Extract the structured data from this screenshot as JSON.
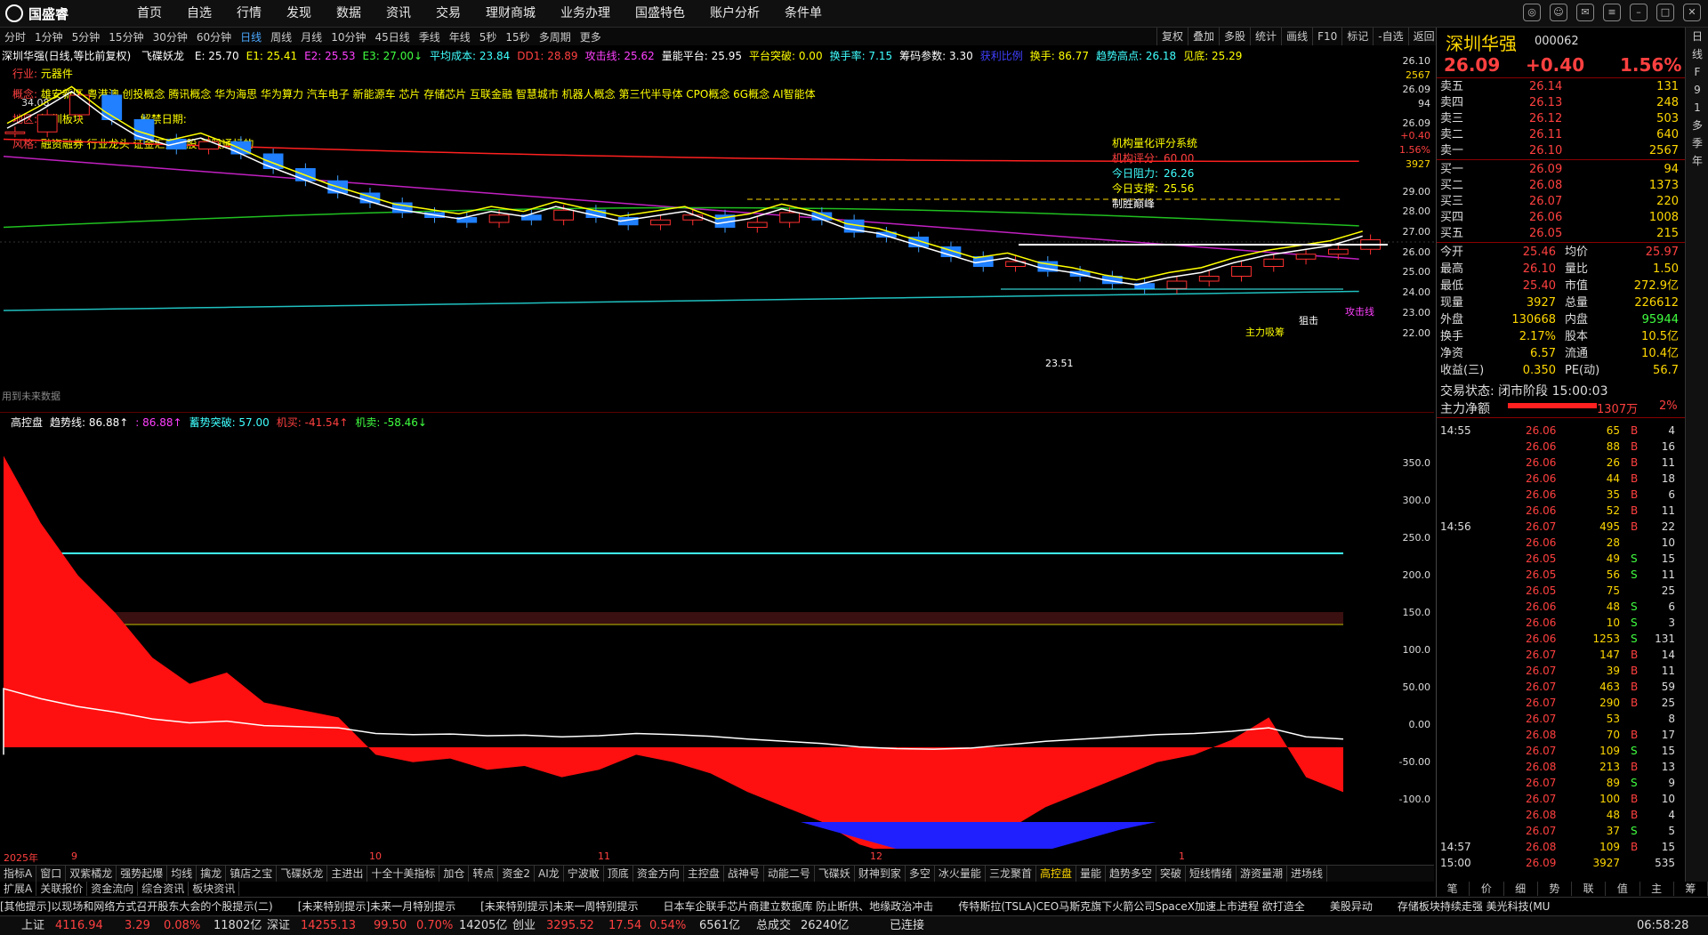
{
  "app": {
    "logo": "国盛睿"
  },
  "nav": [
    "首页",
    "自选",
    "行情",
    "发现",
    "数据",
    "资讯",
    "交易",
    "理财商城",
    "业务办理",
    "国盛特色",
    "账户分析",
    "条件单"
  ],
  "periods": [
    "分时",
    "1分钟",
    "5分钟",
    "15分钟",
    "30分钟",
    "60分钟",
    "日线",
    "周线",
    "月线",
    "10分钟",
    "45日线",
    "季线",
    "年线",
    "5秒",
    "15秒",
    "多周期",
    "更多"
  ],
  "active_period": "日线",
  "toolbar": [
    "复权",
    "叠加",
    "多股",
    "统计",
    "画线",
    "F10",
    "标记",
    "-自选",
    "返回"
  ],
  "header_line": {
    "stock": "深圳华强(日线,等比前复权)",
    "indicator": "飞碟妖龙",
    "items": [
      {
        "t": "E: 25.70",
        "c": "#ffffff"
      },
      {
        "t": "E1: 25.41",
        "c": "#ffff00"
      },
      {
        "t": "E2: 25.53",
        "c": "#ff40ff"
      },
      {
        "t": "E3: 27.00↓",
        "c": "#40ff40"
      },
      {
        "t": "平均成本: 23.84",
        "c": "#40ffff"
      },
      {
        "t": "DD1: 28.89",
        "c": "#ff4040"
      },
      {
        "t": "攻击线: 25.62",
        "c": "#ff40ff"
      },
      {
        "t": "量能平台: 25.95",
        "c": "#ffffff"
      },
      {
        "t": "平台突破: 0.00",
        "c": "#ffff00"
      },
      {
        "t": "换手率: 7.15",
        "c": "#40ffff"
      },
      {
        "t": "筹码参数: 3.30",
        "c": "#ffffff"
      },
      {
        "t": "获利比例",
        "c": "#4040ff"
      },
      {
        "t": "换手: 86.77",
        "c": "#ffff00"
      },
      {
        "t": "趋势高点: 26.18",
        "c": "#40ffff"
      },
      {
        "t": "见底: 25.29",
        "c": "#ffff00"
      }
    ]
  },
  "info": {
    "industry_label": "行业:",
    "industry": "元器件",
    "concept_label": "概念:",
    "concepts": "雄安新区 粤港澳 创投概念 腾讯概念 华为海思 华为算力 汽车电子 新能源车 芯片 存储芯片 互联金融 智慧城市 机器人概念 第三代半导体 CPO概念 6G概念 AI智能体",
    "region_label": "地区:",
    "region": "深圳板块",
    "unlock_label": "解禁日期:",
    "style_label": "风格:",
    "style": "融资融券 行业龙头 证金汇金持股 深股通标的",
    "price_mark": "34.08"
  },
  "score_box": {
    "title": "机构量化评分系统",
    "rows": [
      {
        "k": "机构评分:",
        "v": "60.00",
        "c": "#ff4040"
      },
      {
        "k": "今日阻力:",
        "v": "26.26",
        "c": "#40ffff"
      },
      {
        "k": "今日支撑:",
        "v": "25.56",
        "c": "#ffff00"
      },
      {
        "k": "制胜巅峰",
        "v": "",
        "c": "#ffffff"
      }
    ]
  },
  "chart_labels": {
    "future": "用到未来数据",
    "low_mark": "23.51",
    "main_buy": "主力吸筹",
    "attack": "攻击线",
    "fight": "狙击"
  },
  "yaxis_top": [
    "26.10",
    "2567",
    "26.09",
    "94",
    "26.09",
    "+0.40",
    "1.56%",
    "3927",
    "29.00",
    "28.00",
    "27.00",
    "26.00",
    "25.00",
    "24.00",
    "23.00",
    "22.00"
  ],
  "yaxis_bot": [
    "350.0",
    "300.0",
    "250.0",
    "200.0",
    "150.0",
    "100.0",
    "50.00",
    "0.00",
    "-50.00",
    "-100.0"
  ],
  "xaxis": [
    "2025年",
    "9",
    "10",
    "11",
    "12",
    "1"
  ],
  "sub_header": {
    "items": [
      {
        "t": "高控盘",
        "c": "#ffffff"
      },
      {
        "t": "趋势线: 86.88↑",
        "c": "#ffffff"
      },
      {
        "t": ": 86.88↑",
        "c": "#ff40ff"
      },
      {
        "t": "蓄势突破: 57.00",
        "c": "#40ffff"
      },
      {
        "t": "机买: -41.54↑",
        "c": "#ff4040"
      },
      {
        "t": "机卖: -58.46↓",
        "c": "#40ff40"
      }
    ]
  },
  "quote": {
    "name": "深圳华强",
    "code": "000062",
    "price": "26.09",
    "change": "+0.40",
    "pct": "1.56%",
    "asks": [
      {
        "l": "卖五",
        "p": "26.14",
        "v": "131"
      },
      {
        "l": "卖四",
        "p": "26.13",
        "v": "248"
      },
      {
        "l": "卖三",
        "p": "26.12",
        "v": "503"
      },
      {
        "l": "卖二",
        "p": "26.11",
        "v": "640"
      },
      {
        "l": "卖一",
        "p": "26.10",
        "v": "2567"
      }
    ],
    "bids": [
      {
        "l": "买一",
        "p": "26.09",
        "v": "94"
      },
      {
        "l": "买二",
        "p": "26.08",
        "v": "1373"
      },
      {
        "l": "买三",
        "p": "26.07",
        "v": "220"
      },
      {
        "l": "买四",
        "p": "26.06",
        "v": "1008"
      },
      {
        "l": "买五",
        "p": "26.05",
        "v": "215"
      }
    ],
    "stats": [
      {
        "a": "今开",
        "av": "25.46",
        "b": "均价",
        "bv": "25.97"
      },
      {
        "a": "最高",
        "av": "26.10",
        "b": "量比",
        "bv": "1.50"
      },
      {
        "a": "最低",
        "av": "25.40",
        "b": "市值",
        "bv": "272.9亿"
      },
      {
        "a": "现量",
        "av": "3927",
        "b": "总量",
        "bv": "226612"
      },
      {
        "a": "外盘",
        "av": "130668",
        "b": "内盘",
        "bv": "95944"
      },
      {
        "a": "换手",
        "av": "2.17%",
        "b": "股本",
        "bv": "10.5亿"
      },
      {
        "a": "净资",
        "av": "6.57",
        "b": "流通",
        "bv": "10.4亿"
      },
      {
        "a": "收益(三)",
        "av": "0.350",
        "b": "PE(动)",
        "bv": "56.7"
      }
    ],
    "trade_state": "交易状态: 闭市阶段 15:00:03",
    "main_net_label": "主力净额",
    "main_net": "1307万",
    "main_net_pct": "2%"
  },
  "ticks": [
    {
      "t": "14:55",
      "p": "26.06",
      "v": "65",
      "d": "B",
      "n": "4"
    },
    {
      "t": "",
      "p": "26.06",
      "v": "88",
      "d": "B",
      "n": "16"
    },
    {
      "t": "",
      "p": "26.06",
      "v": "26",
      "d": "B",
      "n": "11"
    },
    {
      "t": "",
      "p": "26.06",
      "v": "44",
      "d": "B",
      "n": "18"
    },
    {
      "t": "",
      "p": "26.06",
      "v": "35",
      "d": "B",
      "n": "6"
    },
    {
      "t": "",
      "p": "26.06",
      "v": "52",
      "d": "B",
      "n": "11"
    },
    {
      "t": "14:56",
      "p": "26.07",
      "v": "495",
      "d": "B",
      "n": "22"
    },
    {
      "t": "",
      "p": "26.06",
      "v": "28",
      "d": "",
      "n": "10"
    },
    {
      "t": "",
      "p": "26.05",
      "v": "49",
      "d": "S",
      "n": "15"
    },
    {
      "t": "",
      "p": "26.05",
      "v": "56",
      "d": "S",
      "n": "11"
    },
    {
      "t": "",
      "p": "26.05",
      "v": "75",
      "d": "",
      "n": "25"
    },
    {
      "t": "",
      "p": "26.06",
      "v": "48",
      "d": "S",
      "n": "6"
    },
    {
      "t": "",
      "p": "26.06",
      "v": "10",
      "d": "S",
      "n": "3"
    },
    {
      "t": "",
      "p": "26.06",
      "v": "1253",
      "d": "S",
      "n": "131"
    },
    {
      "t": "",
      "p": "26.07",
      "v": "147",
      "d": "B",
      "n": "14"
    },
    {
      "t": "",
      "p": "26.07",
      "v": "39",
      "d": "B",
      "n": "11"
    },
    {
      "t": "",
      "p": "26.07",
      "v": "463",
      "d": "B",
      "n": "59"
    },
    {
      "t": "",
      "p": "26.07",
      "v": "290",
      "d": "B",
      "n": "25"
    },
    {
      "t": "",
      "p": "26.07",
      "v": "53",
      "d": "",
      "n": "8"
    },
    {
      "t": "",
      "p": "26.08",
      "v": "70",
      "d": "B",
      "n": "17"
    },
    {
      "t": "",
      "p": "26.07",
      "v": "109",
      "d": "S",
      "n": "15"
    },
    {
      "t": "",
      "p": "26.08",
      "v": "213",
      "d": "B",
      "n": "13"
    },
    {
      "t": "",
      "p": "26.07",
      "v": "89",
      "d": "S",
      "n": "9"
    },
    {
      "t": "",
      "p": "26.07",
      "v": "100",
      "d": "B",
      "n": "10"
    },
    {
      "t": "",
      "p": "26.08",
      "v": "48",
      "d": "B",
      "n": "4"
    },
    {
      "t": "",
      "p": "26.07",
      "v": "37",
      "d": "S",
      "n": "5"
    },
    {
      "t": "14:57",
      "p": "26.08",
      "v": "109",
      "d": "B",
      "n": "15"
    },
    {
      "t": "15:00",
      "p": "26.09",
      "v": "3927",
      "d": "",
      "n": "535"
    }
  ],
  "rside": [
    "日",
    "线",
    "F",
    "9",
    "1",
    "多",
    "季",
    "年"
  ],
  "indicator_tabs": [
    "指标A",
    "窗口",
    "双紫橘龙",
    "强势起爆",
    "均线",
    "擒龙",
    "镇店之宝",
    "飞碟妖龙",
    "主进出",
    "十全十美指标",
    "加仓",
    "转点",
    "资金2",
    "AI龙",
    "宁波敢",
    "顶底",
    "资金方向",
    "主控盘",
    "战神号",
    "动能二号",
    "飞碟妖",
    "财神到家",
    "多空",
    "冰火量能",
    "三龙聚首",
    "高控盘",
    "量能",
    "趋势多空",
    "突破",
    "短线情绪",
    "游资量潮",
    "进场线"
  ],
  "active_indicator": "高控盘",
  "bottom_tabs": [
    "扩展A",
    "关联报价",
    "资金流向",
    "综合资讯",
    "板块资讯"
  ],
  "right_tabs": [
    "笔",
    "价",
    "细",
    "势",
    "联",
    "值",
    "主",
    "筹"
  ],
  "news": [
    "[其他提示]以现场和网络方式召开股东大会的个股提示(二)",
    "[未来特别提示]未来一月特别提示",
    "[未来特别提示]未来一周特别提示",
    "日本车企联手芯片商建立数据库 防止断供、地缘政治冲击",
    "传特斯拉(TSLA)CEO马斯克旗下火箭公司SpaceX加速上市进程 欲打造全",
    "美股异动",
    "存储板块持续走强 美光科技(MU"
  ],
  "status": {
    "sh_label": "上证",
    "sh": "4116.94",
    "sh_chg": "3.29",
    "sh_pct": "0.08%",
    "sh_amt": "11802亿",
    "sz_label": "深证",
    "sz": "14255.13",
    "sz_chg": "99.50",
    "sz_pct": "0.70%",
    "sz_amt": "14205亿",
    "cy_label": "创业",
    "cy": "3295.52",
    "cy_chg": "17.54",
    "cy_pct": "0.54%",
    "cy_amt": "6561亿",
    "total_label": "总成交",
    "total": "26240亿",
    "conn": "已连接",
    "time": "06:58:28"
  },
  "chart_data": {
    "type": "line",
    "candles_close": [
      30.5,
      31.2,
      32.0,
      31.0,
      30.2,
      29.8,
      30.1,
      29.6,
      29.0,
      28.5,
      28.0,
      27.6,
      27.2,
      27.0,
      26.8,
      27.1,
      26.9,
      27.3,
      27.0,
      26.7,
      26.9,
      27.1,
      26.6,
      26.8,
      27.2,
      26.9,
      26.4,
      26.2,
      25.8,
      25.4,
      25.0,
      25.2,
      24.8,
      24.6,
      24.3,
      24.1,
      24.4,
      24.6,
      25.0,
      25.3,
      25.5,
      25.7,
      26.09
    ],
    "sub_values": [
      390,
      300,
      230,
      180,
      120,
      85,
      100,
      60,
      50,
      40,
      -10,
      -20,
      -15,
      -30,
      -25,
      -40,
      -30,
      -10,
      -20,
      -35,
      -60,
      -80,
      -100,
      -130,
      -145,
      -150,
      -140,
      -110,
      -80,
      -60,
      -40,
      -20,
      -10,
      10,
      40,
      -40,
      -60
    ],
    "ylim_top": [
      22,
      30
    ],
    "ylim_bot": [
      -100,
      400
    ]
  }
}
